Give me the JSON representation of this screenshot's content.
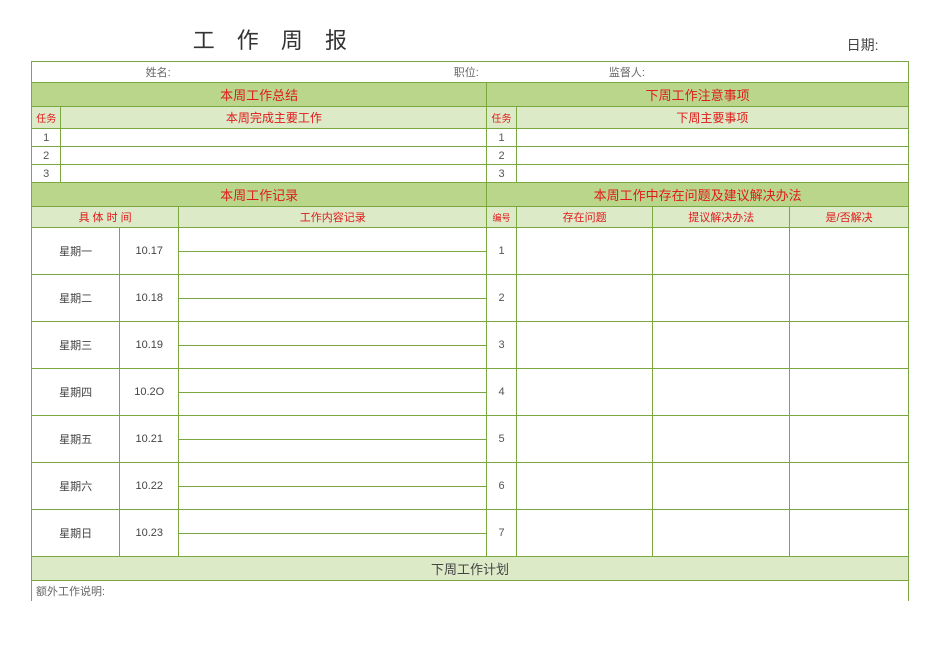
{
  "title": "工 作 周 报",
  "dateLabel": "日期:",
  "metaRow": {
    "nameLabel": "姓名:",
    "positionLabel": "职位:",
    "supervisorLabel": "监督人:"
  },
  "leftSection": {
    "header": "本周工作总结",
    "subHeader": "本周完成主要工作",
    "taskLabel": "任务",
    "rows": [
      "1",
      "2",
      "3"
    ]
  },
  "rightSection": {
    "header": "下周工作注意事项",
    "subHeader": "下周主要事项",
    "taskLabel": "任务",
    "rows": [
      "1",
      "2",
      "3"
    ]
  },
  "logSection": {
    "header": "本周工作记录",
    "timeHeader": "具 体 时 间",
    "contentHeader": "工作内容记录",
    "days": [
      {
        "name": "星期一",
        "date": "10.17"
      },
      {
        "name": "星期二",
        "date": "10.18"
      },
      {
        "name": "星期三",
        "date": "10.19"
      },
      {
        "name": "星期四",
        "date": "10.2O"
      },
      {
        "name": "星期五",
        "date": "10.21"
      },
      {
        "name": "星期六",
        "date": "10.22"
      },
      {
        "name": "星期日",
        "date": "10.23"
      }
    ]
  },
  "issueSection": {
    "header": "本周工作中存在问题及建议解决办法",
    "col1": "编号",
    "col2": "存在问题",
    "col3": "提议解决办法",
    "col4": "是/否解决",
    "rows": [
      "1",
      "2",
      "3",
      "4",
      "5",
      "6",
      "7"
    ]
  },
  "nextWeekPlan": "下周工作计划",
  "extraLabel": "额外工作说明:",
  "chart_data": {
    "type": "table",
    "title": "工作周报",
    "sections": [
      {
        "name": "本周工作总结",
        "task_numbers": [
          1,
          2,
          3
        ]
      },
      {
        "name": "下周工作注意事项",
        "task_numbers": [
          1,
          2,
          3
        ]
      },
      {
        "name": "本周工作记录",
        "days": [
          "星期一",
          "星期二",
          "星期三",
          "星期四",
          "星期五",
          "星期六",
          "星期日"
        ],
        "dates": [
          "10.17",
          "10.18",
          "10.19",
          "10.20",
          "10.21",
          "10.22",
          "10.23"
        ]
      },
      {
        "name": "本周工作中存在问题及建议解决办法",
        "row_numbers": [
          1,
          2,
          3,
          4,
          5,
          6,
          7
        ],
        "columns": [
          "编号",
          "存在问题",
          "提议解决办法",
          "是/否解决"
        ]
      }
    ]
  }
}
